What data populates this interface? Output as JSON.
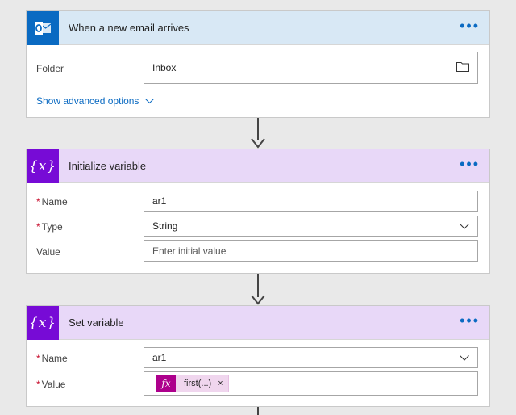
{
  "trigger": {
    "title": "When a new email arrives",
    "more_label": "•••",
    "folder_label": "Folder",
    "folder_value": "Inbox",
    "advanced_link": "Show advanced options"
  },
  "init_var": {
    "title": "Initialize variable",
    "more_label": "•••",
    "name_label": "Name",
    "name_value": "ar1",
    "type_label": "Type",
    "type_value": "String",
    "value_label": "Value",
    "value_placeholder": "Enter initial value"
  },
  "set_var": {
    "title": "Set variable",
    "more_label": "•••",
    "name_label": "Name",
    "name_value": "ar1",
    "value_label": "Value",
    "token_label": "first(...)",
    "token_remove": "×"
  },
  "required_marker": "*",
  "colors": {
    "outlook_blue": "#0a6ac2",
    "variable_purple": "#770bd6",
    "expression_magenta": "#ad008c"
  },
  "icons": {
    "trigger": "outlook-icon",
    "variable": "variable-icon",
    "folder": "folder-icon",
    "chevron": "chevron-down-icon",
    "expression": "fx-icon"
  }
}
